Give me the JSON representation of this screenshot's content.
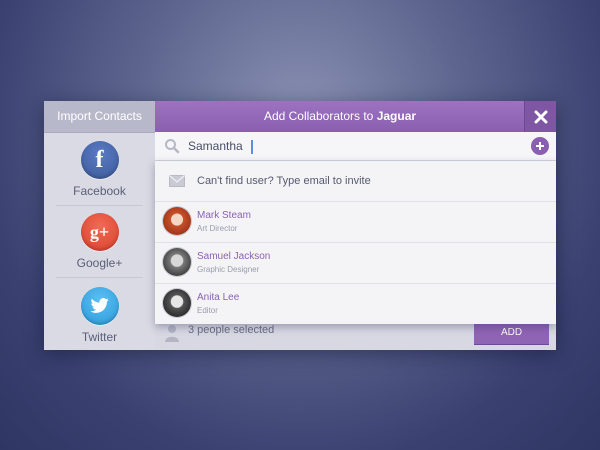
{
  "sidebar": {
    "title": "Import Contacts",
    "sources": [
      {
        "label": "Facebook",
        "icon": "facebook-icon",
        "glyph": "f",
        "color": "#3b5998"
      },
      {
        "label": "Google+",
        "icon": "google-plus-icon",
        "glyph": "g+",
        "color": "#dd4b39"
      },
      {
        "label": "Twitter",
        "icon": "twitter-icon",
        "color": "#2aa3e6"
      }
    ]
  },
  "header": {
    "title_prefix": "Add Collaborators to",
    "project_name": "Jaguar",
    "accent": "#8a5fb0"
  },
  "search": {
    "value": "Samantha"
  },
  "dropdown": {
    "invite_text": "Can't find user? Type email to invite",
    "people": [
      {
        "name": "Mark Steam",
        "role": "Art Director"
      },
      {
        "name": "Samuel Jackson",
        "role": "Graphic Designer"
      },
      {
        "name": "Anita Lee",
        "role": "Editor"
      }
    ]
  },
  "footer": {
    "selected_text": "3 people selected",
    "add_label": "ADD"
  }
}
